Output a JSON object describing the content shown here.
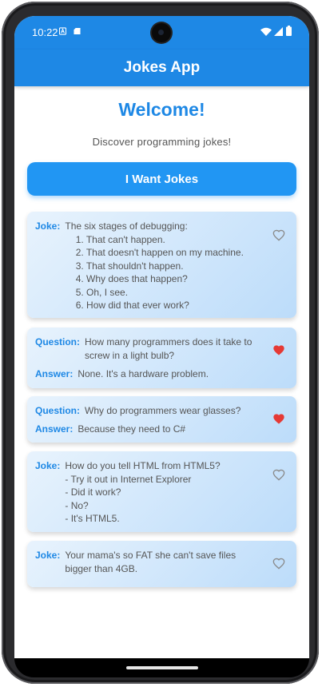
{
  "status_bar": {
    "time": "10:22"
  },
  "app_bar": {
    "title": "Jokes App"
  },
  "main": {
    "welcome": "Welcome!",
    "subtitle": "Discover programming jokes!",
    "button_label": "I Want Jokes"
  },
  "jokes": [
    {
      "type": "single",
      "label": "Joke:",
      "lines": [
        "The six stages of debugging:",
        "    1. That can't happen.",
        "    2. That doesn't happen on my machine.",
        "    3. That shouldn't happen.",
        "    4. Why does that happen?",
        "    5. Oh, I see.",
        "    6. How did that ever work?"
      ],
      "favorite": false
    },
    {
      "type": "twopart",
      "question_label": "Question:",
      "question_lines": [
        "How many programmers does it take to",
        "screw in a light bulb?"
      ],
      "answer_label": "Answer:",
      "answer_lines": [
        "None. It's a hardware problem."
      ],
      "favorite": true
    },
    {
      "type": "twopart",
      "question_label": "Question:",
      "question_lines": [
        "Why do programmers wear glasses?"
      ],
      "answer_label": "Answer:",
      "answer_lines": [
        "Because they need to C#"
      ],
      "favorite": true
    },
    {
      "type": "single",
      "label": "Joke:",
      "lines": [
        "How do you tell HTML from HTML5?",
        "- Try it out in Internet Explorer",
        "- Did it work?",
        "- No?",
        "- It's HTML5."
      ],
      "favorite": false
    },
    {
      "type": "single",
      "label": "Joke:",
      "lines": [
        "Your mama's so FAT she can't save files",
        "bigger than 4GB."
      ],
      "favorite": false
    }
  ],
  "colors": {
    "primary": "#1e88e5",
    "heart_active": "#e53935",
    "heart_inactive": "#8a8a8a"
  },
  "icons": {
    "favorite_on": "heart-filled-icon",
    "favorite_off": "heart-outline-icon"
  }
}
